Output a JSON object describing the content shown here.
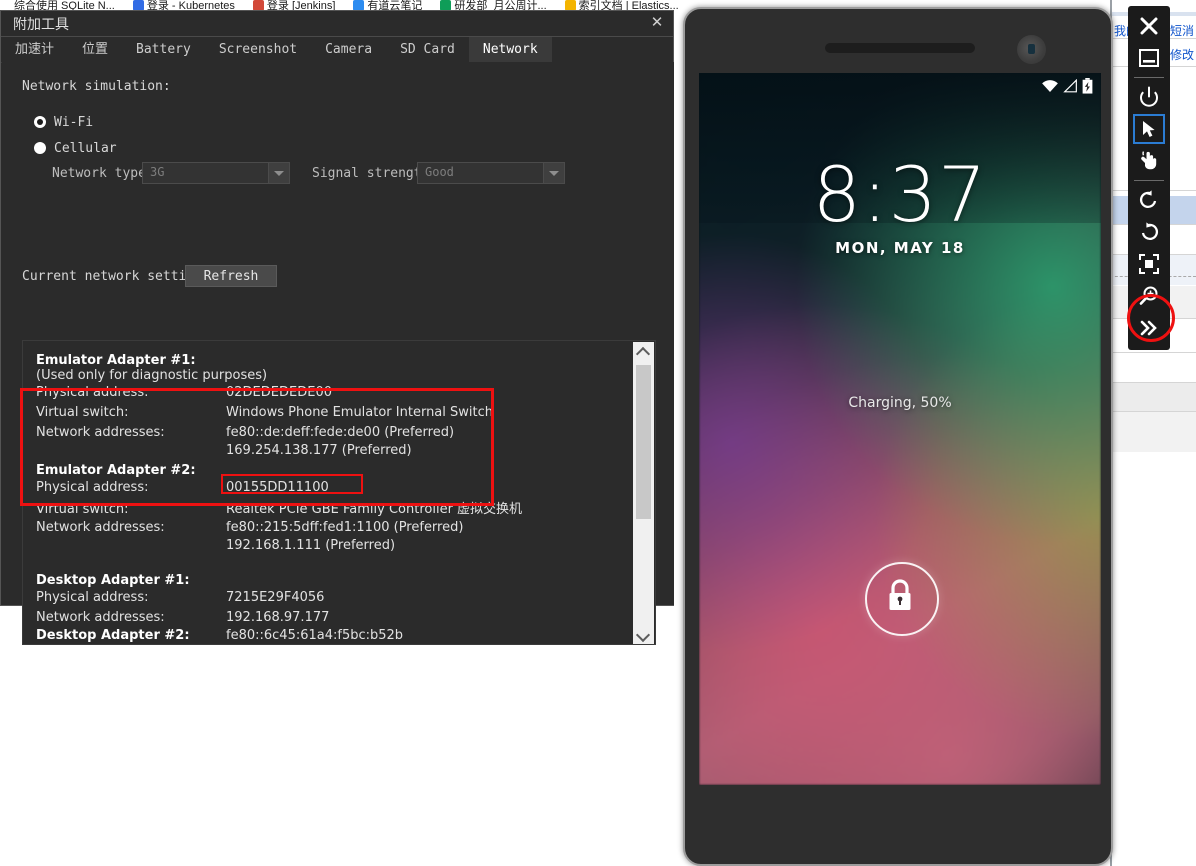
{
  "browser_bookmarks": [
    {
      "label": "综合使用 SQLite N...",
      "color": "#ffffff"
    },
    {
      "label": "登录 - Kubernetes",
      "color": "#326ce5"
    },
    {
      "label": "登录 [Jenkins]",
      "color": "#d24939"
    },
    {
      "label": "有道云笔记",
      "color": "#2d8cf0"
    },
    {
      "label": "研发部_月公周计...",
      "color": "#0f9d58"
    },
    {
      "label": "索引文档 | Elastics...",
      "color": "#f4b400"
    }
  ],
  "background_page": {
    "links": [
      "我的",
      "短消",
      "修改"
    ]
  },
  "tools_window": {
    "title": "附加工具",
    "close_label": "✕",
    "tabs": [
      {
        "label": "加速计",
        "cjk": true,
        "active": false
      },
      {
        "label": "位置",
        "cjk": true,
        "active": false
      },
      {
        "label": "Battery",
        "cjk": false,
        "active": false
      },
      {
        "label": "Screenshot",
        "cjk": false,
        "active": false
      },
      {
        "label": "Camera",
        "cjk": false,
        "active": false
      },
      {
        "label": "SD Card",
        "cjk": false,
        "active": false
      },
      {
        "label": "Network",
        "cjk": false,
        "active": true
      }
    ],
    "network": {
      "simulation_label": "Network simulation:",
      "radios": [
        {
          "label": "Wi-Fi",
          "checked": true
        },
        {
          "label": "Cellular",
          "checked": false
        }
      ],
      "network_type_label": "Network type:",
      "network_type_value": "3G",
      "signal_strength_label": "Signal strength:",
      "signal_strength_value": "Good",
      "current_settings_label": "Current network settings:",
      "refresh_label": "Refresh"
    },
    "adapters": [
      {
        "title": "Emulator Adapter #1:",
        "subtitle": "(Used only for diagnostic purposes)",
        "rows": [
          {
            "key": "Physical address:",
            "value": "02DEDEDEDE00"
          },
          {
            "key": "Virtual switch:",
            "value": "Windows Phone Emulator Internal Switch"
          },
          {
            "key": "Network addresses:",
            "value": "fe80::de:deff:fede:de00 (Preferred)"
          },
          {
            "key": "",
            "value": "169.254.138.177 (Preferred)"
          }
        ]
      },
      {
        "title": "Emulator Adapter #2:",
        "subtitle": "",
        "rows": [
          {
            "key": "Physical address:",
            "value": "00155DD11100"
          },
          {
            "key": "Virtual switch:",
            "value": "Realtek PCIe GBE Family Controller 虚拟交换机"
          },
          {
            "key": "Network addresses:",
            "value": "fe80::215:5dff:fed1:1100 (Preferred)"
          },
          {
            "key": "",
            "value": "192.168.1.111 (Preferred)"
          }
        ]
      },
      {
        "title": "Desktop Adapter #1:",
        "subtitle": "",
        "rows": [
          {
            "key": "Physical address:",
            "value": "7215E29F4056"
          },
          {
            "key": "Network addresses:",
            "value": "192.168.97.177"
          },
          {
            "key": "",
            "value": "fe80::6c45:61a4:f5bc:b52b"
          }
        ]
      },
      {
        "title": "Desktop Adapter #2:",
        "subtitle": "",
        "rows": []
      }
    ],
    "annotation_color": "#ee1111"
  },
  "phone": {
    "status_icons": [
      "wifi-icon",
      "signal-icon",
      "battery-charging-icon"
    ],
    "lock_screen": {
      "time": "8:37",
      "date": "MON, MAY 18",
      "battery_status": "Charging, 50%",
      "lock_icon": "lock-icon"
    }
  },
  "emulator_toolbar": {
    "items": [
      {
        "name": "close-icon",
        "selected": false
      },
      {
        "name": "minimize-icon",
        "selected": false
      },
      {
        "name": "power-icon",
        "selected": false
      },
      {
        "name": "cursor-pointer-icon",
        "selected": true
      },
      {
        "name": "touch-hand-icon",
        "selected": false
      },
      {
        "name": "rotate-left-icon",
        "selected": false
      },
      {
        "name": "rotate-right-icon",
        "selected": false
      },
      {
        "name": "fit-to-screen-icon",
        "selected": false
      },
      {
        "name": "zoom-in-icon",
        "selected": false
      },
      {
        "name": "expand-more-icon",
        "selected": false
      }
    ],
    "highlight_color": "#ee1111"
  }
}
